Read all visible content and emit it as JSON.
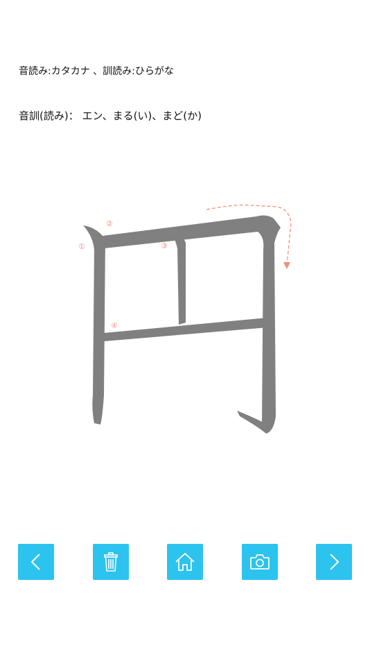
{
  "legend_text": "音読み:カタカナ 、訓読み:ひらがな",
  "reading_text": "音訓(読み)： エン、まる(い)、まど(か)",
  "kanji": {
    "stroke_color": "#808080",
    "label_color": "#f0907c",
    "stroke_labels": [
      "①",
      "②",
      "③",
      "④"
    ]
  },
  "toolbar": {
    "accent": "#2cc3ee",
    "buttons": [
      {
        "name": "previous",
        "icon": "chevron-left-icon"
      },
      {
        "name": "clear",
        "icon": "trash-icon"
      },
      {
        "name": "home",
        "icon": "home-icon"
      },
      {
        "name": "screenshot",
        "icon": "camera-icon"
      },
      {
        "name": "next",
        "icon": "chevron-right-icon"
      }
    ]
  }
}
